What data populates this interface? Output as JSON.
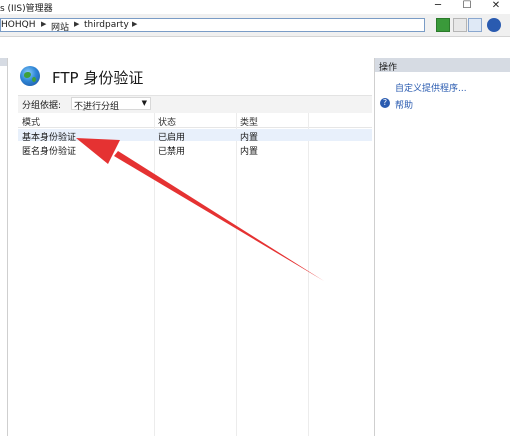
{
  "window": {
    "title": "s (IIS)管理器",
    "minimize": "─",
    "maximize": "☐",
    "close": "✕"
  },
  "address": {
    "crumbs": [
      "HOHQH",
      "网站",
      "thirdparty"
    ],
    "separator": "▶"
  },
  "feature": {
    "title": "FTP 身份验证",
    "group_label": "分组依据:",
    "group_value": "不进行分组"
  },
  "grid": {
    "headers": [
      "模式",
      "状态",
      "类型"
    ],
    "rows": [
      {
        "mode": "基本身份验证",
        "status": "已启用",
        "type": "内置"
      },
      {
        "mode": "匿名身份验证",
        "status": "已禁用",
        "type": "内置"
      }
    ]
  },
  "actions": {
    "title": "操作",
    "custom_provider": "自定义提供程序...",
    "help": "帮助"
  },
  "left_pane": {
    "label_fragment": ""
  },
  "colors": {
    "annotation_arrow": "#e53232",
    "pane_header": "#d6dbe3",
    "link": "#2a5bb0"
  }
}
